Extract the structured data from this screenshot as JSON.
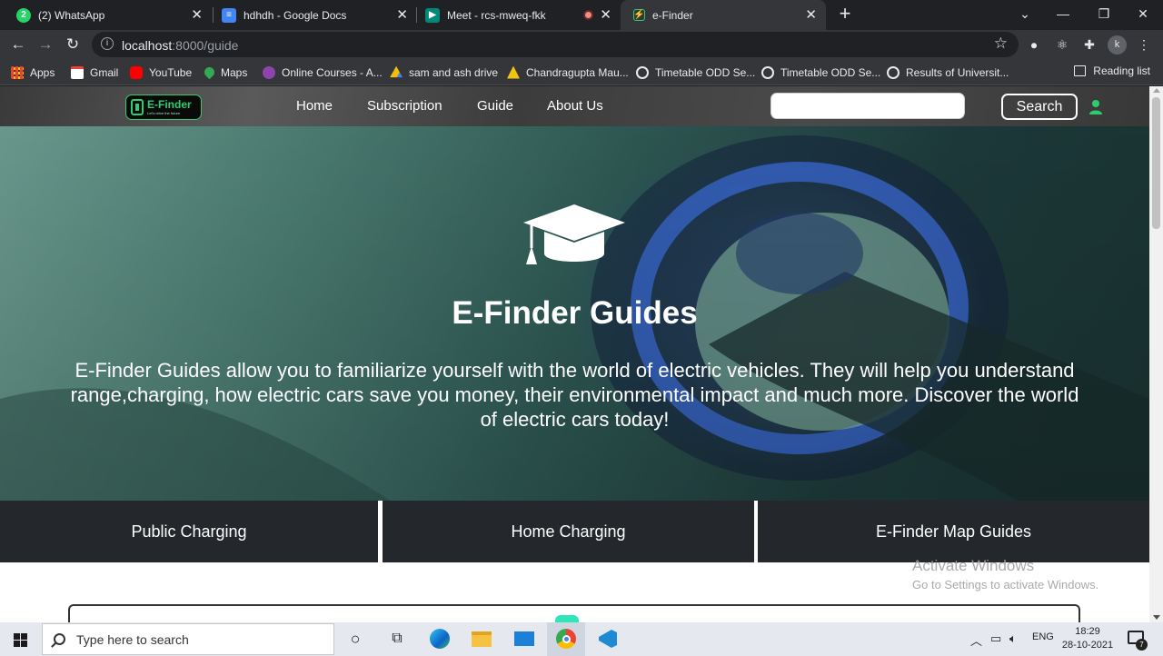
{
  "browser": {
    "tabs": [
      {
        "title": "(2) WhatsApp",
        "icon": "whatsapp-icon",
        "color": "#25d366"
      },
      {
        "title": "hdhdh - Google Docs",
        "icon": "google-docs-icon",
        "color": "#4285f4"
      },
      {
        "title": "Meet - rcs-mweq-fkk",
        "icon": "google-meet-icon",
        "color": "#00897b"
      },
      {
        "title": "e-Finder",
        "icon": "e-finder-favicon",
        "color": "#2ecc71"
      }
    ],
    "address": {
      "host": "localhost",
      "path": ":8000/guide"
    },
    "profile_initial": "k",
    "bookmarks": [
      {
        "label": "Apps",
        "icon": "apps-grid-icon"
      },
      {
        "label": "Gmail",
        "icon": "gmail-icon"
      },
      {
        "label": "YouTube",
        "icon": "youtube-icon"
      },
      {
        "label": "Maps",
        "icon": "maps-icon"
      },
      {
        "label": "Online Courses - A...",
        "icon": "courses-icon"
      },
      {
        "label": "sam and ash drive",
        "icon": "drive-icon"
      },
      {
        "label": "Chandragupta Mau...",
        "icon": "bookmark-icon"
      },
      {
        "label": "Timetable ODD Se...",
        "icon": "globe-icon"
      },
      {
        "label": "Timetable ODD Se...",
        "icon": "globe-icon"
      },
      {
        "label": "Results of Universit...",
        "icon": "globe-icon"
      }
    ],
    "reading_list": "Reading list"
  },
  "site": {
    "logo": {
      "name": "E-Finder",
      "tagline": "Let's drive the future"
    },
    "nav": [
      "Home",
      "Subscription",
      "Guide",
      "About Us"
    ],
    "search_value": "",
    "search_button": "Search",
    "accent": "#2ecc71",
    "hero": {
      "title": "E-Finder Guides",
      "description": "E-Finder Guides allow you to familiarize yourself with the world of electric vehicles. They will help you understand range,charging, how electric cars save you money, their environmental impact and much more. Discover the world of electric cars today!"
    },
    "categories": [
      "Public Charging",
      "Home Charging",
      "E-Finder Map Guides"
    ]
  },
  "watermark": {
    "line1": "Activate Windows",
    "line2": "Go to Settings to activate Windows."
  },
  "taskbar": {
    "search_placeholder": "Type here to search",
    "language": "ENG",
    "time": "18:29",
    "date": "28-10-2021",
    "notifications": "7"
  }
}
